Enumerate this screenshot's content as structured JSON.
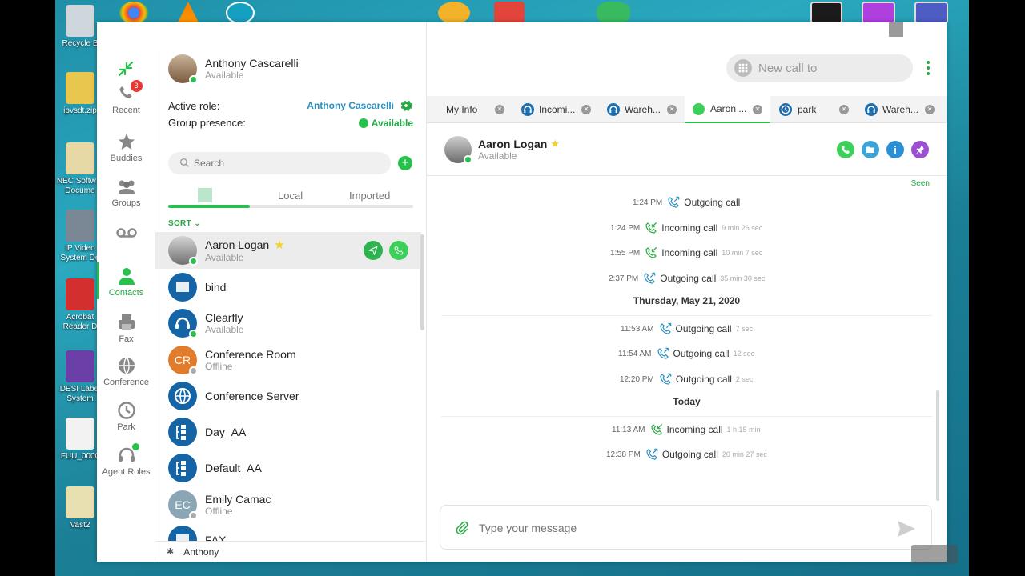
{
  "desktop": {
    "icons": [
      {
        "label": "Recycle B",
        "color": "#cfd6dc"
      },
      {
        "label": "ipvsdt.zip",
        "color": "#e9c64e"
      },
      {
        "label": "NEC Softw & Docume",
        "color": "#e6d9a6"
      },
      {
        "label": "IP Video System De",
        "color": "#7a8895"
      },
      {
        "label": "Acrobat Reader D",
        "color": "#d32f2f"
      },
      {
        "label": "DESI Label System",
        "color": "#6a3fa8"
      },
      {
        "label": "FUU_0000",
        "color": "#f2f2f2"
      },
      {
        "label": "Vast2",
        "color": "#e8e0b0"
      }
    ]
  },
  "app": {
    "colors": {
      "accent": "#27c04a",
      "link": "#2b8fbf",
      "badge": "#e53935",
      "tile": "#1565a6"
    },
    "rail": [
      {
        "key": "recent",
        "label": "Recent",
        "icon": "recent-icon",
        "badge": "3"
      },
      {
        "key": "buddies",
        "label": "Buddies",
        "icon": "star-icon"
      },
      {
        "key": "groups",
        "label": "Groups",
        "icon": "groups-icon"
      },
      {
        "key": "voicemail",
        "label": "",
        "icon": "voicemail-icon"
      },
      {
        "key": "contacts",
        "label": "Contacts",
        "icon": "contacts-icon",
        "active": true
      },
      {
        "key": "fax",
        "label": "Fax",
        "icon": "fax-icon"
      },
      {
        "key": "conference",
        "label": "Conference",
        "icon": "globe-icon"
      },
      {
        "key": "park",
        "label": "Park",
        "icon": "clock-icon"
      },
      {
        "key": "agent_roles",
        "label": "Agent Roles",
        "icon": "headset-icon"
      }
    ],
    "me": {
      "name": "Anthony Cascarelli",
      "status": "Available"
    },
    "role": {
      "label": "Active role:",
      "value": "Anthony Cascarelli"
    },
    "presence": {
      "label": "Group presence:",
      "value": "Available"
    },
    "search": {
      "placeholder": "Search"
    },
    "filter_tabs": {
      "local": "Local",
      "imported": "Imported"
    },
    "sort_label": "SORT",
    "contacts": [
      {
        "name": "Aaron Logan",
        "status": "Available",
        "avatar": "photo",
        "starred": true,
        "selected": true
      },
      {
        "name": "bind",
        "status": "",
        "avatar": "tile"
      },
      {
        "name": "Clearfly",
        "status": "Available",
        "avatar": "tile-headset"
      },
      {
        "name": "Conference Room",
        "status": "Offline",
        "avatar": "initials",
        "initials": "CR",
        "color": "#e07c2c"
      },
      {
        "name": "Conference Server",
        "status": "",
        "avatar": "tile-globe"
      },
      {
        "name": "Day_AA",
        "status": "",
        "avatar": "tile-tree"
      },
      {
        "name": "Default_AA",
        "status": "",
        "avatar": "tile-tree"
      },
      {
        "name": "Emily Camac",
        "status": "Offline",
        "avatar": "initials",
        "initials": "EC",
        "color": "#8aa6b5"
      },
      {
        "name": "FAX",
        "status": "",
        "avatar": "tile"
      }
    ],
    "footer": {
      "user": "Anthony"
    },
    "new_call": {
      "placeholder": "New call to"
    },
    "tabs": [
      {
        "label": "My Info",
        "icon": ""
      },
      {
        "label": "Incomi...",
        "icon": "headset"
      },
      {
        "label": "Wareh...",
        "icon": "headset"
      },
      {
        "label": "Aaron ...",
        "icon": "status",
        "active": true
      },
      {
        "label": "park",
        "icon": "clock"
      },
      {
        "label": "Wareh...",
        "icon": "headset"
      }
    ],
    "chat_header": {
      "name": "Aaron Logan",
      "status": "Available"
    },
    "seen": "Seen",
    "history": [
      {
        "type": "call",
        "time": "1:24 PM",
        "text": "Outgoing call",
        "duration": "",
        "dir": "out"
      },
      {
        "type": "call",
        "time": "1:24 PM",
        "text": "Incoming call",
        "duration": "9 min 26 sec",
        "dir": "in"
      },
      {
        "type": "call",
        "time": "1:55 PM",
        "text": "Incoming call",
        "duration": "10 min 7 sec",
        "dir": "in"
      },
      {
        "type": "call",
        "time": "2:37 PM",
        "text": "Outgoing call",
        "duration": "35 min 30 sec",
        "dir": "out"
      },
      {
        "type": "day",
        "text": "Thursday, May 21, 2020"
      },
      {
        "type": "call",
        "time": "11:53 AM",
        "text": "Outgoing call",
        "duration": "7 sec",
        "dir": "out"
      },
      {
        "type": "call",
        "time": "11:54 AM",
        "text": "Outgoing call",
        "duration": "12 sec",
        "dir": "out"
      },
      {
        "type": "call",
        "time": "12:20 PM",
        "text": "Outgoing call",
        "duration": "2 sec",
        "dir": "out"
      },
      {
        "type": "day",
        "text": "Today"
      },
      {
        "type": "call",
        "time": "11:13 AM",
        "text": "Incoming call",
        "duration": "1 h 15 min",
        "dir": "in"
      },
      {
        "type": "call",
        "time": "12:38 PM",
        "text": "Outgoing call",
        "duration": "20 min 27 sec",
        "dir": "out"
      }
    ],
    "composer": {
      "placeholder": "Type your message"
    }
  }
}
